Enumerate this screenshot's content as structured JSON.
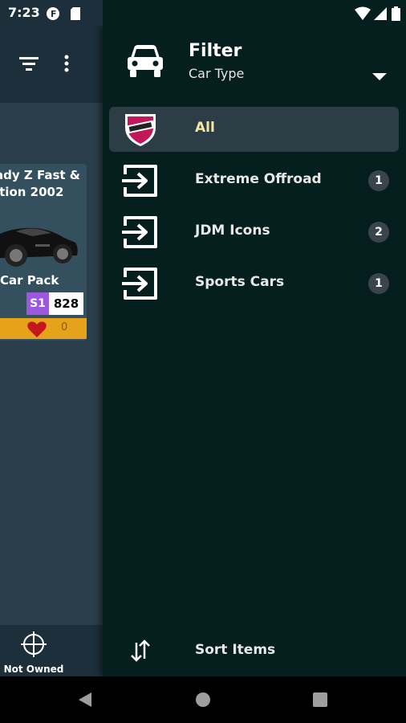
{
  "status_bar": {
    "time": "7:23"
  },
  "background_app": {
    "card": {
      "title_line1": "ady Z Fast &",
      "title_line2": "ition 2002",
      "pack": "Car Pack",
      "class": "S1",
      "pi": "828",
      "likes": "0"
    },
    "bottom_nav": {
      "not_owned_label": "Not Owned"
    }
  },
  "drawer": {
    "title": "Filter",
    "subtitle": "Car Type",
    "items": [
      {
        "label": "All",
        "count": "",
        "selected": true
      },
      {
        "label": "Extreme Offroad",
        "count": "1",
        "selected": false
      },
      {
        "label": "JDM Icons",
        "count": "2",
        "selected": false
      },
      {
        "label": "Sports Cars",
        "count": "1",
        "selected": false
      }
    ],
    "sort_label": "Sort Items"
  },
  "colors": {
    "drawer_bg": "#051e1e",
    "selected_bg": "#2d3d46",
    "selected_text": "#f5e7a2",
    "class_badge": "#9c59e0",
    "footer_accent": "#e6a21a"
  }
}
